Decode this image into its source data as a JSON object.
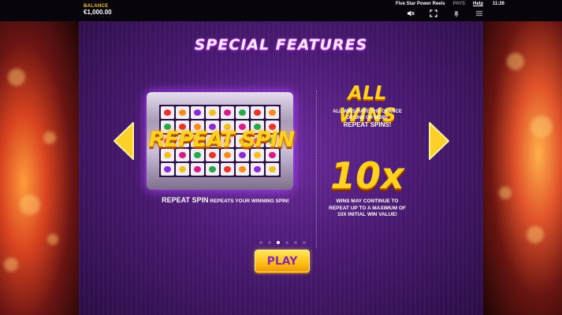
{
  "topbar": {
    "balance_label": "BALANCE",
    "balance_value": "€1,000.00",
    "game_name": "Five Star Power Reels",
    "pays_label": "PAYS",
    "help_label": "Help",
    "clock": "11:26",
    "icons": [
      "mute-icon",
      "fullscreen-icon",
      "notifications-icon",
      "menu-icon"
    ]
  },
  "title": "SPECIAL FEATURES",
  "left_feature": {
    "banner": "REPEAT SPIN",
    "caption_highlight": "REPEAT SPIN",
    "caption_rest": " REPEATS YOUR WINNING SPIN!"
  },
  "right_feature": {
    "allwins_title": "ALL WINS",
    "allwins_line1": "ALL WINS HAVE THE CHANCE",
    "allwins_line2": "OF ONE OR MORE",
    "allwins_line3": "REPEAT SPINS!",
    "multiplier": "10x",
    "multiplier_line1": "WINS MAY CONTINUE TO",
    "multiplier_line2": "REPEAT UP TO A MAXIMUM OF",
    "multiplier_line3": "10X INITIAL WIN VALUE!"
  },
  "pagination": {
    "total": 6,
    "active": 2
  },
  "play_label": "PLAY",
  "colors": {
    "accent_gold": "#ffd21f",
    "purple_bg": "#4a1a73",
    "play_text": "#8a2aa6"
  }
}
